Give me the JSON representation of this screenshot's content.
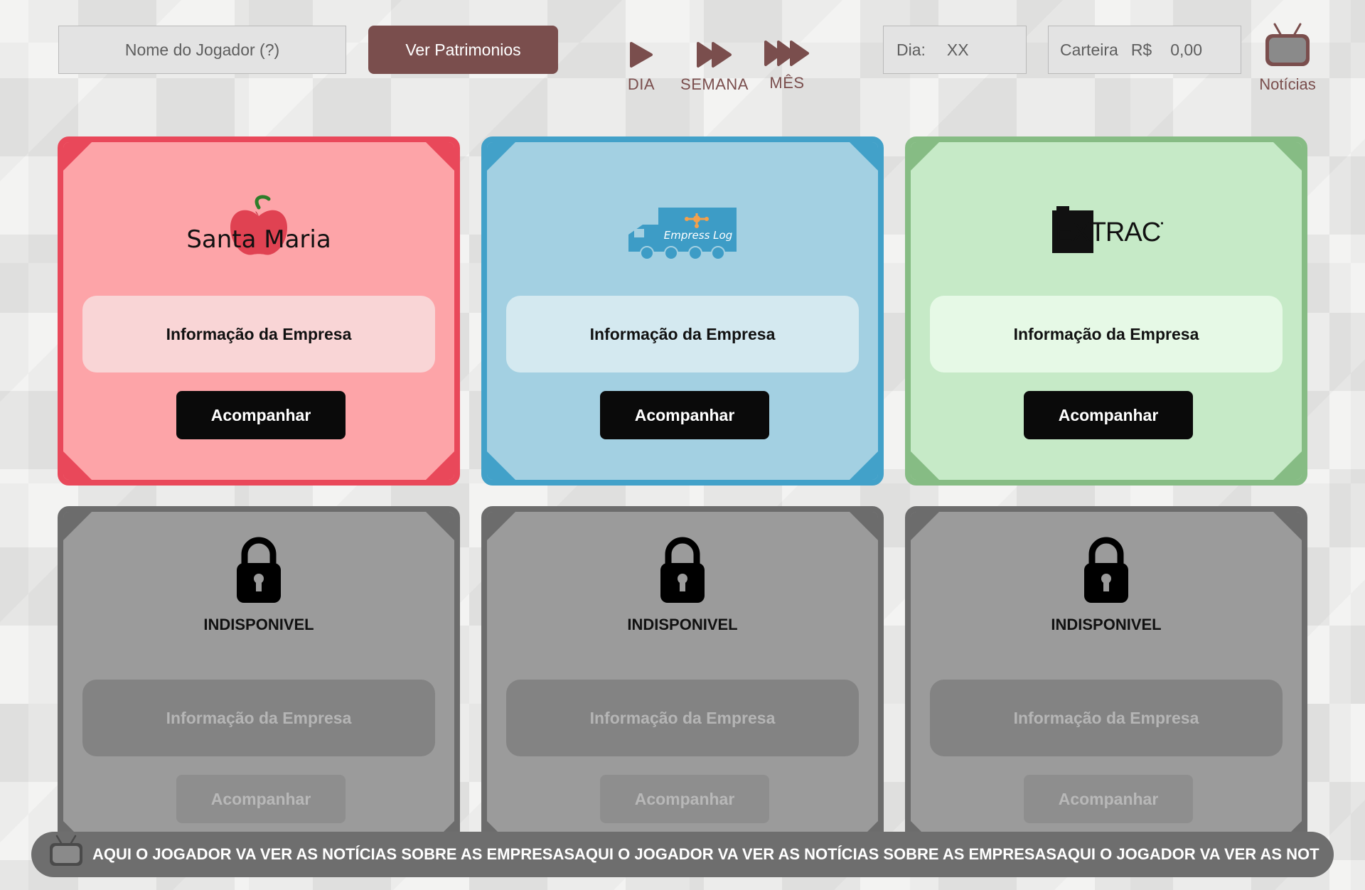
{
  "header": {
    "player_placeholder": "Nome do Jogador (?)",
    "patrimonio_label": "Ver Patrimonios",
    "speed": {
      "dia": "DIA",
      "semana": "SEMANA",
      "mes": "MÊS"
    },
    "day": {
      "label": "Dia:",
      "value": "XX"
    },
    "wallet": {
      "label": "Carteira",
      "currency": "R$",
      "value": "0,00"
    },
    "news_label": "Notícias"
  },
  "cards": [
    {
      "company_logo_text": "Santa Maria",
      "info_label": "Informação da Empresa",
      "action_label": "Acompanhar",
      "color": "#e9485a"
    },
    {
      "company_logo_text": "Empress Log",
      "info_label": "Informação da Empresa",
      "action_label": "Acompanhar",
      "color": "#42a1c9"
    },
    {
      "company_logo_text": "EXTRACT",
      "info_label": "Informação da Empresa",
      "action_label": "Acompanhar",
      "color": "#86bc84"
    }
  ],
  "locked_cards": [
    {
      "status": "INDISPONIVEL",
      "info_label": "Informação da Empresa",
      "action_label": "Acompanhar"
    },
    {
      "status": "INDISPONIVEL",
      "info_label": "Informação da Empresa",
      "action_label": "Acompanhar"
    },
    {
      "status": "INDISPONIVEL",
      "info_label": "Informação da Empresa",
      "action_label": "Acompanhar"
    }
  ],
  "ticker": {
    "text": "AQUI O JOGADOR VA VER AS NOTÍCIAS SOBRE AS EMPRESASAQUI O JOGADOR VA VER AS NOTÍCIAS SOBRE AS EMPRESASAQUI O JOGADOR VA VER AS NOTÍCIAS"
  },
  "colors": {
    "accent": "#7a4e4d",
    "locked": "#9b9b9b"
  }
}
